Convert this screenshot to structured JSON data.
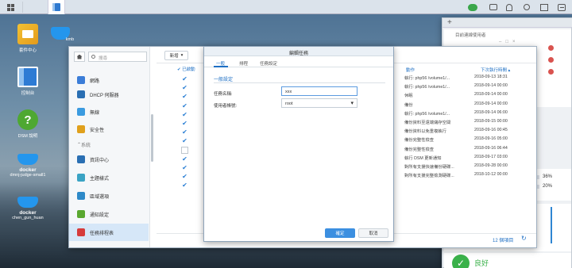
{
  "taskbar": {
    "apps": [
      "main-menu",
      "active-app"
    ]
  },
  "desktop": {
    "icons": [
      {
        "label": "套件中心",
        "icon": "package-center-icon"
      },
      {
        "label": "kmb",
        "icon": "docker-icon"
      },
      {
        "label": "控制台",
        "icon": "control-panel-icon"
      },
      {
        "label": "DSM 說明",
        "icon": "help-icon"
      },
      {
        "label": "docker",
        "sub": "dmnj-judge-small1",
        "icon": "docker-icon"
      },
      {
        "label": "docker",
        "sub": "chen_gun_huan",
        "icon": "docker-icon"
      }
    ]
  },
  "control_panel": {
    "search_placeholder": "搜尋",
    "sidebar": {
      "items": [
        {
          "label": "網路",
          "color": "#3b7dd8"
        },
        {
          "label": "DHCP 伺服器",
          "color": "#2a6fb3"
        },
        {
          "label": "無線",
          "color": "#3b9be0"
        },
        {
          "label": "安全性",
          "color": "#e0a01c"
        },
        {
          "label": "系統",
          "group": true
        },
        {
          "label": "資訊中心",
          "color": "#2a6fb3"
        },
        {
          "label": "主題樣式",
          "color": "#3aa3c4"
        },
        {
          "label": "區域選項",
          "color": "#2d89c8"
        },
        {
          "label": "通知設定",
          "color": "#5aa830"
        },
        {
          "label": "任務排程表",
          "color": "#d63b3b",
          "selected": true
        }
      ]
    },
    "toolbar": {
      "new_label": "新增",
      "enabled_header": "已啟動"
    },
    "checks": [
      true,
      true,
      true,
      true,
      true,
      true,
      true,
      true,
      false,
      true,
      true,
      true,
      true
    ],
    "table": {
      "col_action": "動作",
      "col_next": "下次執行時間",
      "rows": [
        {
          "action": "執行: php56 /volume1/...",
          "next": "2018-09-13 18:31"
        },
        {
          "action": "執行: php56 /volume1/...",
          "next": "2018-09-14 00:00"
        },
        {
          "action": "休眠",
          "next": "2018-09-14 00:00"
        },
        {
          "action": "備份",
          "next": "2018-09-14 00:00"
        },
        {
          "action": "執行: php56 /volume1/...",
          "next": "2018-09-14 06:00"
        },
        {
          "action": "備份資料至遠端儲存空間",
          "next": "2018-09-15 00:00"
        },
        {
          "action": "備份資料以免重複執行",
          "next": "2018-09-16 00:45"
        },
        {
          "action": "備份完整性檢查",
          "next": "2018-09-16 05:00"
        },
        {
          "action": "備份完整性檢查",
          "next": "2018-09-16 06:44"
        },
        {
          "action": "執行 DSM 更新通知",
          "next": "2018-09-17 03:00"
        },
        {
          "action": "對所有支援快速備份硬碟...",
          "next": "2018-09-28 00:00"
        },
        {
          "action": "對所有支援完整檢測硬碟...",
          "next": "2018-10-12 00:00"
        }
      ],
      "footer_count": "12 個項目"
    }
  },
  "dialog": {
    "title": "編輯任務",
    "tabs": [
      "一般",
      "排程",
      "任務設定"
    ],
    "section": "一般設定",
    "task_name_label": "任務名稱:",
    "task_name_value": "xxx",
    "user_label": "使用者帳號:",
    "user_value": "root",
    "ok_label": "確定",
    "cancel_label": "取消"
  },
  "right_panel": {
    "title": "目前連線使用者",
    "percent1": "36%",
    "percent2": "20%",
    "status": "良好"
  }
}
